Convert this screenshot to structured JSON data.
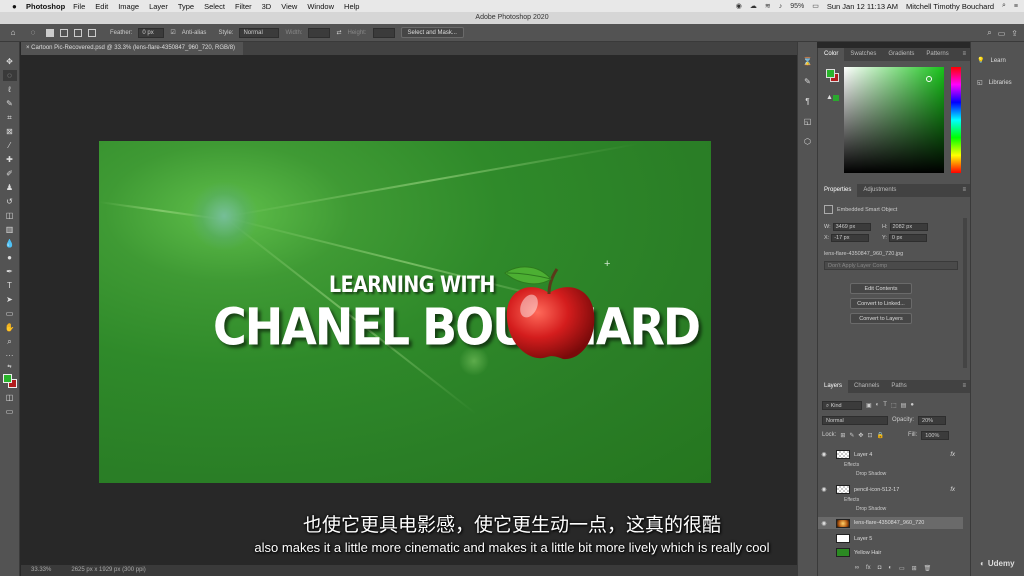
{
  "menubar": {
    "app_name": "Photoshop",
    "items": [
      "File",
      "Edit",
      "Image",
      "Layer",
      "Type",
      "Select",
      "Filter",
      "3D",
      "View",
      "Window",
      "Help"
    ],
    "battery": "95%",
    "datetime": "Sun Jan 12  11:13 AM",
    "user": "Mitchell Timothy Bouchard"
  },
  "window": {
    "title": "Adobe Photoshop 2020"
  },
  "options": {
    "feather_label": "Feather:",
    "feather_value": "0 px",
    "antialias_label": "Anti-alias",
    "style_label": "Style:",
    "style_value": "Normal",
    "width_label": "Width:",
    "height_label": "Height:",
    "select_mask_label": "Select and Mask..."
  },
  "document": {
    "tab_title": "Cartoon Pic-Recovered.psd @ 33.3% (lens-flare-4350847_960_720, RGB/8)",
    "artwork_line1": "LEARNING WITH",
    "artwork_line2": "CHANEL BOUCHARD"
  },
  "status": {
    "zoom": "33.33%",
    "doc_size": "2625 px x 1929 px (300 ppi)"
  },
  "color_panel": {
    "tabs": [
      "Color",
      "Swatches",
      "Gradients",
      "Patterns"
    ],
    "foreground": "#29b42b",
    "background": "#b11d1d"
  },
  "properties_panel": {
    "tabs": [
      "Properties",
      "Adjustments"
    ],
    "type_label": "Embedded Smart Object",
    "w_label": "W:",
    "w_value": "3469 px",
    "h_label": "H:",
    "h_value": "2082 px",
    "x_label": "X:",
    "x_value": "-17 px",
    "y_label": "Y:",
    "y_value": "0 px",
    "filename": "lens-flare-4350847_960_720.jpg",
    "comp_placeholder": "Don't Apply Layer Comp",
    "btn_edit": "Edit Contents",
    "btn_linked": "Convert to Linked...",
    "btn_layers": "Convert to Layers"
  },
  "layers_panel": {
    "tabs": [
      "Layers",
      "Channels",
      "Paths"
    ],
    "filter_kind": "Kind",
    "blend_mode": "Normal",
    "opacity_label": "Opacity:",
    "opacity_value": "20%",
    "lock_label": "Lock:",
    "fill_label": "Fill:",
    "fill_value": "100%",
    "layers": [
      {
        "name": "Layer 4",
        "fx": "fx",
        "effects_label": "Effects",
        "effect": "Drop Shadow"
      },
      {
        "name": "pencil-icon-512-17",
        "fx": "fx",
        "effects_label": "Effects",
        "effect": "Drop Shadow"
      },
      {
        "name": "lens-flare-4350847_960_720"
      },
      {
        "name": "Layer 5"
      },
      {
        "name": "Yellow Hair"
      }
    ]
  },
  "learn_panel": {
    "learn_label": "Learn",
    "libraries_label": "Libraries"
  },
  "subtitles": {
    "chinese": "也使它更具电影感，使它更生动一点，这真的很酷",
    "english": "also makes it a little more cinematic and makes it a little bit more lively which is really cool"
  },
  "watermark": {
    "label": "Udemy"
  }
}
